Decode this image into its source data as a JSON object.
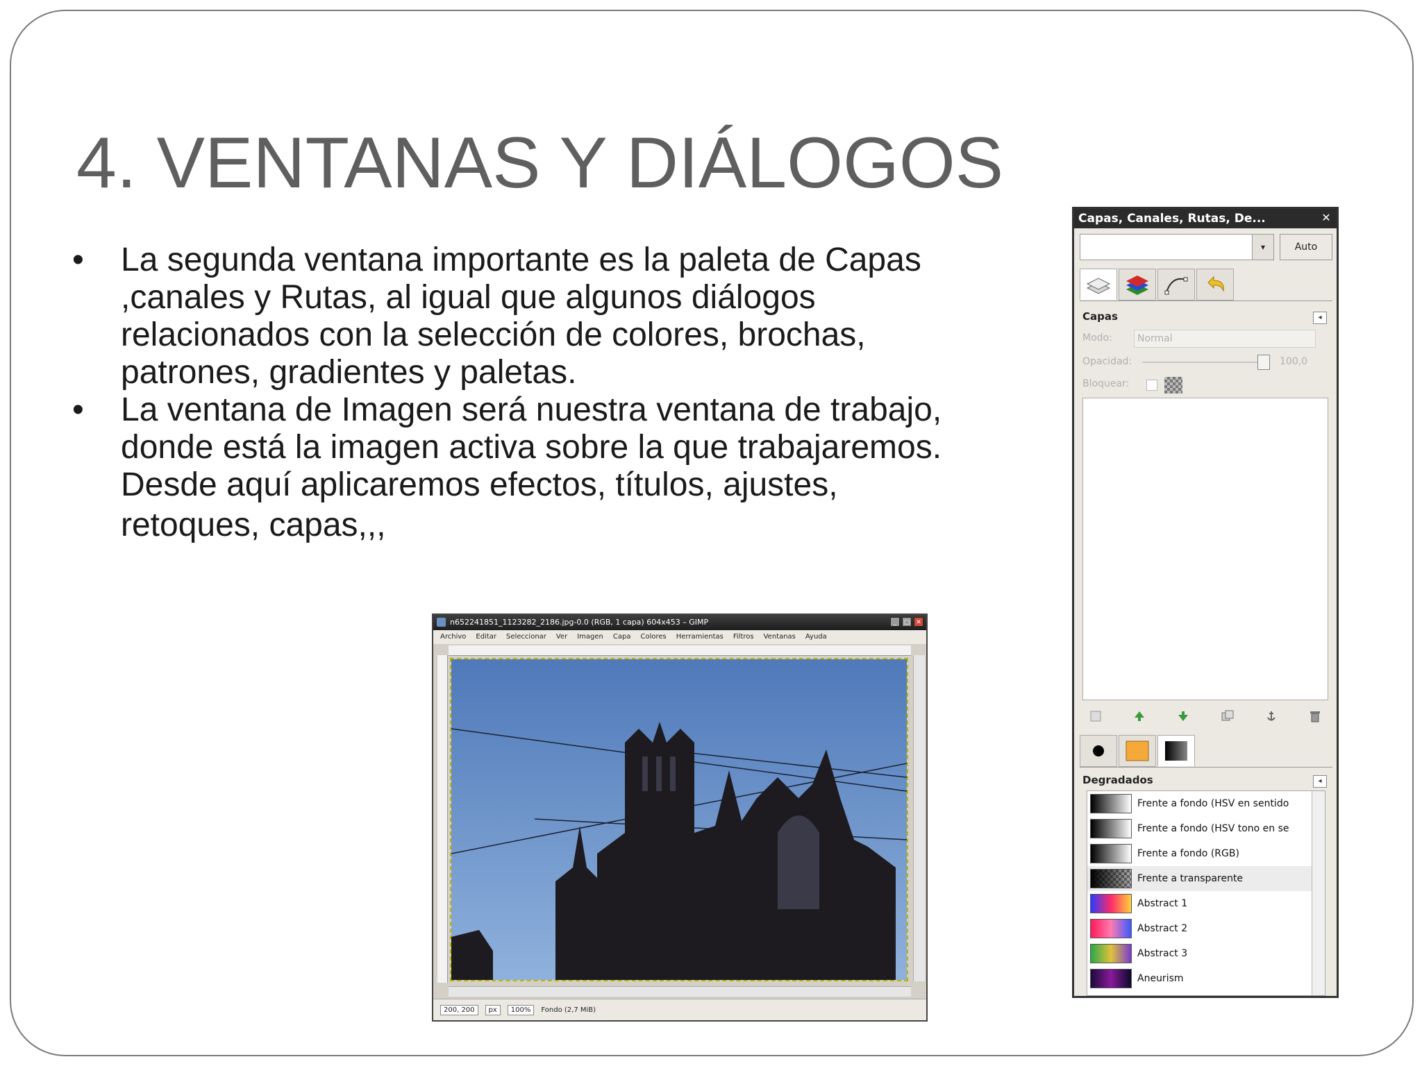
{
  "slide": {
    "title": "4. VENTANAS Y DIÁLOGOS",
    "bullets": [
      {
        "marker": "•",
        "lines": [
          "La segunda ventana importante es la paleta de Capas",
          ",canales y Rutas, al igual que algunos diálogos",
          "relacionados con la selección de colores, brochas,",
          "patrones, gradientes y paletas."
        ]
      },
      {
        "marker": "•",
        "lines": [
          "La ventana de Imagen será nuestra ventana de trabajo,",
          "donde está la imagen activa sobre la que trabajaremos.",
          "Desde aquí aplicaremos efectos, títulos, ajustes,",
          "retoques, capas,,,"
        ]
      }
    ]
  },
  "image_window": {
    "title": "n652241851_1123282_2186.jpg-0.0 (RGB, 1 capa) 604x453 – GIMP",
    "menu": [
      "Archivo",
      "Editar",
      "Seleccionar",
      "Ver",
      "Imagen",
      "Capa",
      "Colores",
      "Herramientas",
      "Filtros",
      "Ventanas",
      "Ayuda"
    ],
    "status": {
      "coords": "200, 200",
      "unit": "px",
      "zoom": "100%",
      "layer_info": "Fondo (2,7 MiB)"
    }
  },
  "dock": {
    "title": "Capas, Canales, Rutas, De...",
    "close_glyph": "✕",
    "auto_label": "Auto",
    "combo_arrow": "▾",
    "layers_panel": {
      "heading": "Capas",
      "mode_label": "Modo:",
      "mode_value": "Normal",
      "opacity_label": "Opacidad:",
      "opacity_value": "100,0",
      "lock_label": "Bloquear:"
    },
    "gradients_panel": {
      "heading": "Degradados",
      "items": [
        {
          "name": "Frente a fondo (HSV en sentido",
          "colors": [
            "#000000",
            "#ffffff"
          ]
        },
        {
          "name": "Frente a fondo (HSV tono en se",
          "colors": [
            "#000000",
            "#ffffff"
          ]
        },
        {
          "name": "Frente a fondo (RGB)",
          "colors": [
            "#000000",
            "#ffffff"
          ]
        },
        {
          "name": "Frente a transparente",
          "colors": [
            "#000000",
            "#7f7f7f"
          ]
        },
        {
          "name": "Abstract 1",
          "colors": [
            "#2a3cff",
            "#ff2a6a",
            "#ffd23a"
          ]
        },
        {
          "name": "Abstract 2",
          "colors": [
            "#ff1a5a",
            "#ff7ab0",
            "#3a5aff"
          ]
        },
        {
          "name": "Abstract 3",
          "colors": [
            "#2aa84a",
            "#e0c23a",
            "#7a3ad0"
          ]
        },
        {
          "name": "Aneurism",
          "colors": [
            "#1a0a3a",
            "#8a1a9a",
            "#0a0a2a"
          ]
        }
      ]
    }
  }
}
